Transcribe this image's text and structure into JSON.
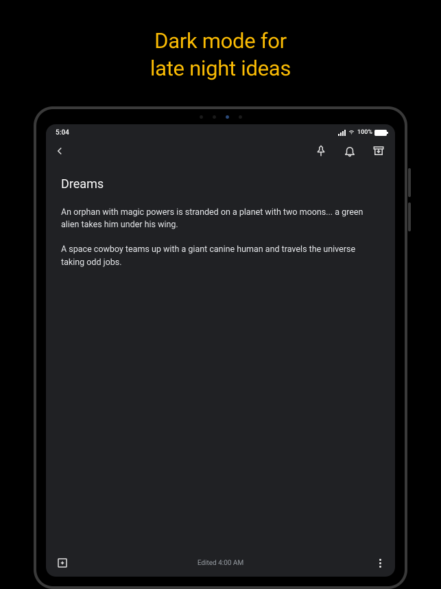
{
  "headline_line1": "Dark mode for",
  "headline_line2": "late night ideas",
  "status": {
    "time": "5:04",
    "battery_pct": "100%"
  },
  "note": {
    "title": "Dreams",
    "body": "An orphan with magic powers is stranded on a planet with two moons... a green alien takes him under his wing.\n\nA space cowboy teams up with a giant canine human and travels the universe taking odd jobs."
  },
  "footer": {
    "edited": "Edited 4:00 AM"
  }
}
